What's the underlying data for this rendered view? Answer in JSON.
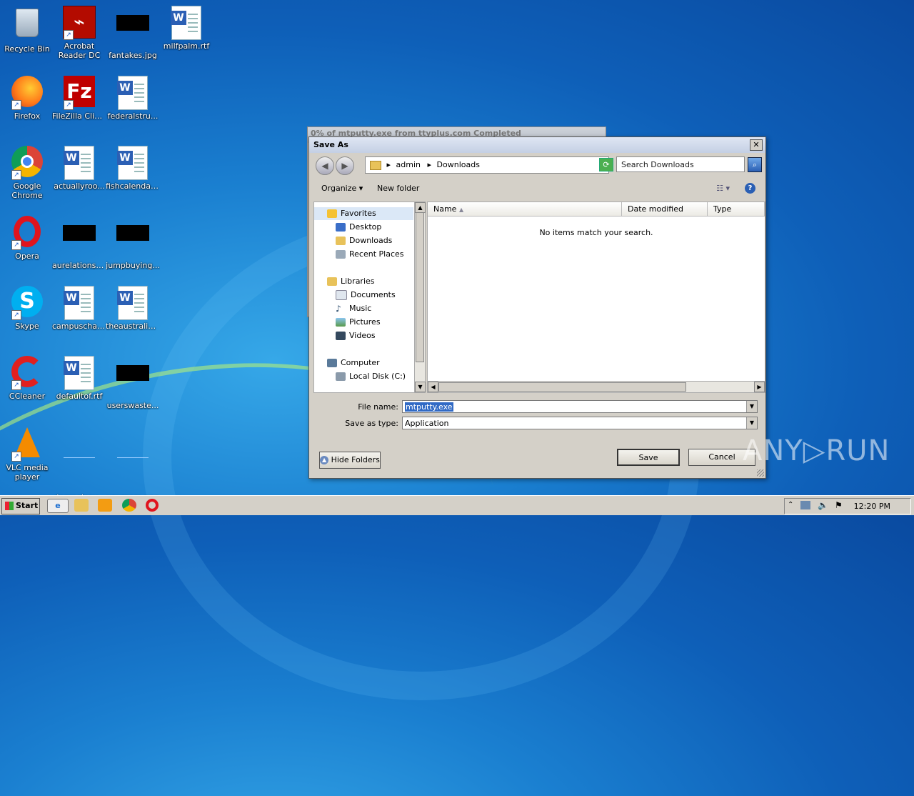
{
  "desktop": {
    "icons": [
      {
        "label": "Recycle Bin"
      },
      {
        "label": "Acrobat Reader DC"
      },
      {
        "label": "fantakes.jpg"
      },
      {
        "label": "milfpalm.rtf"
      },
      {
        "label": "Firefox"
      },
      {
        "label": "FileZilla Client"
      },
      {
        "label": "federalstru..."
      },
      {
        "label": "Google Chrome"
      },
      {
        "label": "actuallyroo..."
      },
      {
        "label": "fishcalendar..."
      },
      {
        "label": "Opera"
      },
      {
        "label": "aurelationsh..."
      },
      {
        "label": "jumpbuying..."
      },
      {
        "label": "Skype"
      },
      {
        "label": "campuschar..."
      },
      {
        "label": "theaustralia..."
      },
      {
        "label": "CCleaner"
      },
      {
        "label": "defaultof.rtf"
      },
      {
        "label": "userswaste..."
      },
      {
        "label": "VLC media player"
      },
      {
        "label": "degreeleav..."
      },
      {
        "label": "youroom.png"
      }
    ]
  },
  "background_dialog": {
    "title": "0% of mtputty.exe from ttyplus.com Completed"
  },
  "save_dialog": {
    "title": "Save As",
    "close_glyph": "✕",
    "back_glyph": "◀",
    "forward_glyph": "▶",
    "address": {
      "part1": "admin",
      "part2": "Downloads",
      "sep": "▸"
    },
    "search_placeholder": "Search Downloads",
    "toolbar": {
      "organize": "Organize",
      "new_folder": "New folder",
      "help": "?"
    },
    "nav": {
      "favorites": "Favorites",
      "desktop": "Desktop",
      "downloads": "Downloads",
      "recent_places": "Recent Places",
      "libraries": "Libraries",
      "documents": "Documents",
      "music": "Music",
      "pictures": "Pictures",
      "videos": "Videos",
      "computer": "Computer",
      "local_disk": "Local Disk (C:)"
    },
    "columns": {
      "name": "Name",
      "date_modified": "Date modified",
      "type": "Type"
    },
    "empty_message": "No items match your search.",
    "file_name_label": "File name:",
    "file_name_value": "mtputty.exe",
    "save_as_type_label": "Save as type:",
    "save_as_type_value": "Application",
    "hide_folders": "Hide Folders",
    "save": "Save",
    "cancel": "Cancel"
  },
  "taskbar": {
    "start": "Start",
    "clock": "12:20 PM"
  },
  "watermark": "ANY▷RUN"
}
